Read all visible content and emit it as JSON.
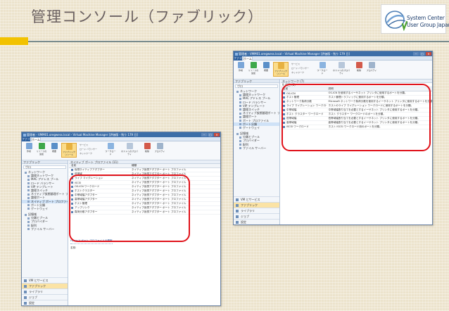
{
  "slide": {
    "title": "管理コンソール（ファブリック）",
    "logo": {
      "line1": "System Center",
      "line2": "User Group Japan"
    }
  },
  "ribbon": {
    "file_tab": "ファイル",
    "home_tab": "ホーム",
    "buttons": [
      "作成",
      "リソースの追加",
      "概要",
      "ファブリックリソース",
      "ワークロード",
      "ホストへのプロパティ",
      "削除",
      "プロパティ"
    ],
    "small_buttons": [
      "サービス",
      "ロード バランサー",
      "ネットワーク"
    ]
  },
  "window_back": {
    "title": "管理者 - VMM01.oregwess.local - Virtual Machine Manager [評価版 - 残り 179 日]",
    "pane_header": "ファブリック",
    "search": "ヴロ",
    "content_header": "ネットワーク (7)",
    "content_sub": "9 項目 (6)",
    "columns": [
      "名前",
      "説明"
    ],
    "rows": [
      [
        "OS-ICN",
        "OS-ICN を使用するイーサネット プリンタに使用するポートを分類。"
      ],
      [
        "ホスト管理",
        "ホスト管理トラフィックに使用するポートを分類。"
      ],
      [
        "ネットワーク負荷分散",
        "Microsoft ネットワーク負荷分散を使用するイーサネット プリンタに使用するポートを分類。"
      ],
      [
        "ライブ マイグレーション ワークロード",
        "ホストのライブ マイグレーション ワークロードに使用するポートを分類。"
      ],
      [
        "中帯域幅",
        "中帯域幅割り当てを必要とするイーサネット プリンタに使用するポートを分類。"
      ],
      [
        "ホスト クラスター ワークロード",
        "ホスト クラスター ワークロードのポートを分類。"
      ],
      [
        "低帯域幅",
        "低帯域幅割り当てを必要とするイーサネット プリンタに使用するポートを分類。"
      ],
      [
        "高帯域幅",
        "高帯域幅割り当てを必要とするイーサネット プリンタに使用するポートを分類。"
      ],
      [
        "iSCSI ワークロード",
        "ホスト iSCSI ワークロード用のポートを分類。"
      ]
    ],
    "tree": [
      {
        "label": "ネットワーク",
        "level": 1
      },
      {
        "label": "論理ネットワーク",
        "level": 2
      },
      {
        "label": "MAC アドレス プール",
        "level": 2
      },
      {
        "label": "ロード バランサー",
        "level": 2
      },
      {
        "label": "VIP テンプレート",
        "level": 2
      },
      {
        "label": "論理スイッチ",
        "level": 2
      },
      {
        "label": "ネイティブ仮想論理ポート プロファイル",
        "level": 2
      },
      {
        "label": "論理ポート",
        "level": 2
      },
      {
        "label": "ポート プロファイル",
        "level": 2
      },
      {
        "label": "ポート分類",
        "level": 2
      },
      {
        "label": "ゲートウェイ",
        "level": 2
      }
    ],
    "tree2": [
      {
        "label": "記憶域",
        "level": 1
      },
      {
        "label": "分類とプール",
        "level": 2
      },
      {
        "label": "プロバイダー",
        "level": 2
      },
      {
        "label": "配列",
        "level": 2
      },
      {
        "label": "ファイル サーバー",
        "level": 2
      }
    ],
    "workspaces": [
      "VM とサービス",
      "ファブリック",
      "ライブラリ",
      "ジョブ",
      "設定"
    ]
  },
  "window_front": {
    "title": "管理者 - VMM01.oregwess.local - Virtual Machine Manager [評価版 - 残り 179 日]",
    "pane_header": "ファブリック",
    "search": "ヴロ",
    "content_header": "ネイティブ ポート プロファイル (11)",
    "columns": [
      "名前",
      "種類"
    ],
    "rows": [
      [
        "仮想ネイティブアダプター",
        "ネイティブ仮想アダプター ポート プロファイル"
      ],
      [
        "低帯域",
        "ネイティブ仮想アダプター ポート プロファイル"
      ],
      [
        "ライブ マイグレーション",
        "ネイティブ仮想アダプター ポート プロファイル"
      ],
      [
        "iSCSI",
        "ネイティブ仮想アダプター ポート プロファイル"
      ],
      [
        "OS-ICN ワークロード",
        "ネイティブ仮想アダプター ポート プロファイル"
      ],
      [
        "ホストクラスター",
        "ネイティブ仮想アダプター ポート プロファイル"
      ],
      [
        "中帯域幅アダプター",
        "ネイティブ仮想アダプター ポート プロファイル"
      ],
      [
        "高帯域幅アダプター",
        "ネイティブ仮想アダプター ポート プロファイル"
      ],
      [
        "ホスト管理",
        "ネイティブ仮想アダプター ポート プロファイル"
      ],
      [
        "アップリンク",
        "ネイティブ仮想アダプター ポート プロファイル"
      ],
      [
        "負荷分散アダプター",
        "ネイティブ仮想アダプター ポート プロファイル"
      ]
    ],
    "detail_title": "Hyper-V ポート プロファイルの情報",
    "detail_label": "名前:",
    "tree": [
      {
        "label": "ネットワーク",
        "level": 1
      },
      {
        "label": "論理ネットワーク",
        "level": 2
      },
      {
        "label": "MAC アドレス プール",
        "level": 2
      },
      {
        "label": "ロード バランサー",
        "level": 2
      },
      {
        "label": "VIP テンプレート",
        "level": 2
      },
      {
        "label": "論理スイッチ",
        "level": 2
      },
      {
        "label": "ネイティブ仮想論理ポート プロファイル",
        "level": 2
      },
      {
        "label": "論理ポート",
        "level": 2
      },
      {
        "label": "ネイティブ ポート プロファイル",
        "level": 2
      },
      {
        "label": "ポート分類",
        "level": 2
      },
      {
        "label": "ゲートウェイ",
        "level": 2
      }
    ],
    "tree2": [
      {
        "label": "記憶域",
        "level": 1
      },
      {
        "label": "分類とプール",
        "level": 2
      },
      {
        "label": "プロバイダー",
        "level": 2
      },
      {
        "label": "配列",
        "level": 2
      },
      {
        "label": "ファイル サーバー",
        "level": 2
      }
    ],
    "workspaces": [
      "VM とサービス",
      "ファブリック",
      "ライブラリ",
      "ジョブ",
      "設定"
    ]
  }
}
